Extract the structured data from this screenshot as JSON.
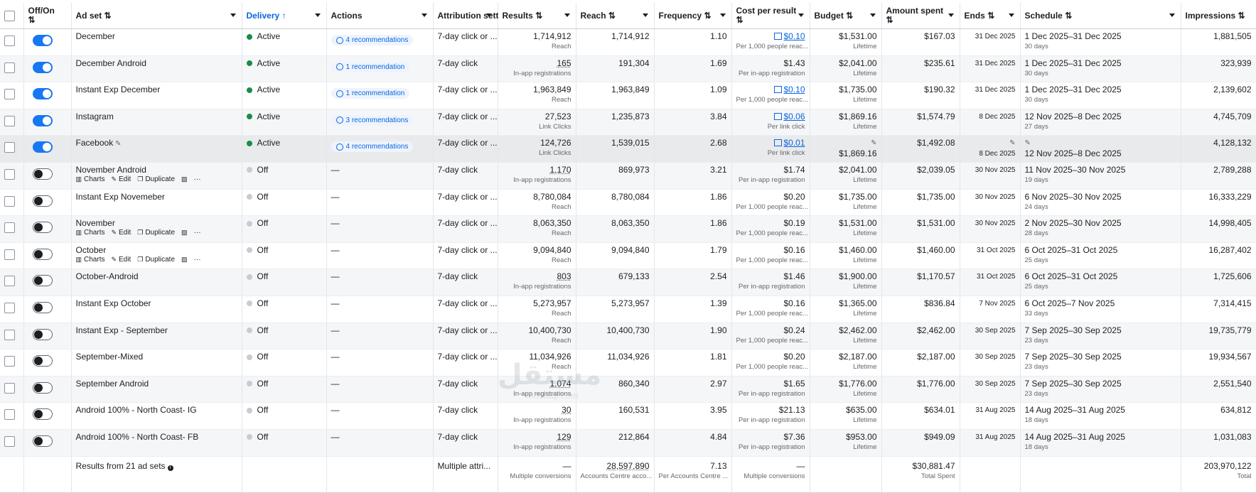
{
  "columns": {
    "off_on": "Off/On",
    "ad_set": "Ad set",
    "delivery": "Delivery",
    "actions": "Actions",
    "attribution": "Attribution setting",
    "results": "Results",
    "reach": "Reach",
    "frequency": "Frequency",
    "cost_per_result": "Cost per result",
    "budget": "Budget",
    "amount_spent": "Amount spent",
    "ends": "Ends",
    "schedule": "Schedule",
    "impressions": "Impressions"
  },
  "row_actions": {
    "charts": "Charts",
    "edit": "Edit",
    "duplicate": "Duplicate",
    "more": "···"
  },
  "rows": [
    {
      "on": true,
      "name": "December",
      "delivery": "Active",
      "actions": "4 recommendations",
      "attribution": "7-day click or ...",
      "results": "1,714,912",
      "results_type": "Reach",
      "reach": "1,714,912",
      "frequency": "1.10",
      "cpr": "$0.10",
      "cpr_sub": "Per 1,000 people reac...",
      "cpr_link": true,
      "budget": "$1,531.00",
      "budget_type": "Lifetime",
      "spent": "$167.03",
      "ends": "31 Dec 2025",
      "schedule": "1 Dec 2025–31 Dec 2025",
      "schedule_sub": "30 days",
      "impressions": "1,881,505"
    },
    {
      "on": true,
      "name": "December Android",
      "delivery": "Active",
      "actions": "1 recommendation",
      "attribution": "7-day click",
      "results": "165",
      "results_type": "In-app registrations",
      "reach": "191,304",
      "frequency": "1.69",
      "cpr": "$1.43",
      "cpr_sub": "Per in-app registration",
      "cpr_link": false,
      "budget": "$2,041.00",
      "budget_type": "Lifetime",
      "spent": "$235.61",
      "ends": "31 Dec 2025",
      "schedule": "1 Dec 2025–31 Dec 2025",
      "schedule_sub": "30 days",
      "impressions": "323,939"
    },
    {
      "on": true,
      "name": "Instant Exp December",
      "delivery": "Active",
      "actions": "1 recommendation",
      "attribution": "7-day click or ...",
      "results": "1,963,849",
      "results_type": "Reach",
      "reach": "1,963,849",
      "frequency": "1.09",
      "cpr": "$0.10",
      "cpr_sub": "Per 1,000 people reac...",
      "cpr_link": true,
      "budget": "$1,735.00",
      "budget_type": "Lifetime",
      "spent": "$190.32",
      "ends": "31 Dec 2025",
      "schedule": "1 Dec 2025–31 Dec 2025",
      "schedule_sub": "30 days",
      "impressions": "2,139,602"
    },
    {
      "on": true,
      "name": "Instagram",
      "delivery": "Active",
      "actions": "3 recommendations",
      "attribution": "7-day click or ...",
      "results": "27,523",
      "results_type": "Link Clicks",
      "reach": "1,235,873",
      "frequency": "3.84",
      "cpr": "$0.06",
      "cpr_sub": "Per link click",
      "cpr_link": true,
      "budget": "$1,869.16",
      "budget_type": "Lifetime",
      "spent": "$1,574.79",
      "ends": "8 Dec 2025",
      "schedule": "12 Nov 2025–8 Dec 2025",
      "schedule_sub": "27 days",
      "impressions": "4,745,709"
    },
    {
      "on": true,
      "name": "Facebook",
      "delivery": "Active",
      "actions": "4 recommendations",
      "attribution": "7-day click or ...",
      "results": "124,726",
      "results_type": "Link Clicks",
      "reach": "1,539,015",
      "frequency": "2.68",
      "cpr": "$0.01",
      "cpr_sub": "Per link click",
      "cpr_link": true,
      "budget": "$1,869.16",
      "budget_type": "",
      "spent": "$1,492.08",
      "ends": "8 Dec 2025",
      "schedule": "12 Nov 2025–8 Dec 2025",
      "schedule_sub": "",
      "impressions": "4,128,132",
      "selected": true
    },
    {
      "on": false,
      "name": "November Android",
      "delivery": "Off",
      "actions": "—",
      "attribution": "7-day click",
      "results": "1,170",
      "results_type": "In-app registrations",
      "reach": "869,973",
      "frequency": "3.21",
      "cpr": "$1.74",
      "cpr_sub": "Per in-app registration",
      "cpr_link": false,
      "budget": "$2,041.00",
      "budget_type": "Lifetime",
      "spent": "$2,039.05",
      "ends": "30 Nov 2025",
      "schedule": "11 Nov 2025–30 Nov 2025",
      "schedule_sub": "19 days",
      "impressions": "2,789,288",
      "hover": true
    },
    {
      "on": false,
      "name": "Instant Exp Novemeber",
      "delivery": "Off",
      "actions": "—",
      "attribution": "7-day click or ...",
      "results": "8,780,084",
      "results_type": "Reach",
      "reach": "8,780,084",
      "frequency": "1.86",
      "cpr": "$0.20",
      "cpr_sub": "Per 1,000 people reac...",
      "cpr_link": false,
      "budget": "$1,735.00",
      "budget_type": "Lifetime",
      "spent": "$1,735.00",
      "ends": "30 Nov 2025",
      "schedule": "6 Nov 2025–30 Nov 2025",
      "schedule_sub": "24 days",
      "impressions": "16,333,229"
    },
    {
      "on": false,
      "name": "November",
      "delivery": "Off",
      "actions": "—",
      "attribution": "7-day click or ...",
      "results": "8,063,350",
      "results_type": "Reach",
      "reach": "8,063,350",
      "frequency": "1.86",
      "cpr": "$0.19",
      "cpr_sub": "Per 1,000 people reac...",
      "cpr_link": false,
      "budget": "$1,531.00",
      "budget_type": "Lifetime",
      "spent": "$1,531.00",
      "ends": "30 Nov 2025",
      "schedule": "2 Nov 2025–30 Nov 2025",
      "schedule_sub": "28 days",
      "impressions": "14,998,405",
      "hover": true
    },
    {
      "on": false,
      "name": "October",
      "delivery": "Off",
      "actions": "—",
      "attribution": "7-day click or ...",
      "results": "9,094,840",
      "results_type": "Reach",
      "reach": "9,094,840",
      "frequency": "1.79",
      "cpr": "$0.16",
      "cpr_sub": "Per 1,000 people reac...",
      "cpr_link": false,
      "budget": "$1,460.00",
      "budget_type": "Lifetime",
      "spent": "$1,460.00",
      "ends": "31 Oct 2025",
      "schedule": "6 Oct 2025–31 Oct 2025",
      "schedule_sub": "25 days",
      "impressions": "16,287,402",
      "hover": true
    },
    {
      "on": false,
      "name": "October-Android",
      "delivery": "Off",
      "actions": "—",
      "attribution": "7-day click",
      "results": "803",
      "results_type": "In-app registrations",
      "reach": "679,133",
      "frequency": "2.54",
      "cpr": "$1.46",
      "cpr_sub": "Per in-app registration",
      "cpr_link": false,
      "budget": "$1,900.00",
      "budget_type": "Lifetime",
      "spent": "$1,170.57",
      "ends": "31 Oct 2025",
      "schedule": "6 Oct 2025–31 Oct 2025",
      "schedule_sub": "25 days",
      "impressions": "1,725,606"
    },
    {
      "on": false,
      "name": "Instant Exp October",
      "delivery": "Off",
      "actions": "—",
      "attribution": "7-day click or ...",
      "results": "5,273,957",
      "results_type": "Reach",
      "reach": "5,273,957",
      "frequency": "1.39",
      "cpr": "$0.16",
      "cpr_sub": "Per 1,000 people reac...",
      "cpr_link": false,
      "budget": "$1,365.00",
      "budget_type": "Lifetime",
      "spent": "$836.84",
      "ends": "7 Nov 2025",
      "schedule": "6 Oct 2025–7 Nov 2025",
      "schedule_sub": "33 days",
      "impressions": "7,314,415"
    },
    {
      "on": false,
      "name": "Instant Exp - September",
      "delivery": "Off",
      "actions": "—",
      "attribution": "7-day click or ...",
      "results": "10,400,730",
      "results_type": "Reach",
      "reach": "10,400,730",
      "frequency": "1.90",
      "cpr": "$0.24",
      "cpr_sub": "Per 1,000 people reac...",
      "cpr_link": false,
      "budget": "$2,462.00",
      "budget_type": "Lifetime",
      "spent": "$2,462.00",
      "ends": "30 Sep 2025",
      "schedule": "7 Sep 2025–30 Sep 2025",
      "schedule_sub": "23 days",
      "impressions": "19,735,779"
    },
    {
      "on": false,
      "name": "September-Mixed",
      "delivery": "Off",
      "actions": "—",
      "attribution": "7-day click or ...",
      "results": "11,034,926",
      "results_type": "Reach",
      "reach": "11,034,926",
      "frequency": "1.81",
      "cpr": "$0.20",
      "cpr_sub": "Per 1,000 people reac...",
      "cpr_link": false,
      "budget": "$2,187.00",
      "budget_type": "Lifetime",
      "spent": "$2,187.00",
      "ends": "30 Sep 2025",
      "schedule": "7 Sep 2025–30 Sep 2025",
      "schedule_sub": "23 days",
      "impressions": "19,934,567"
    },
    {
      "on": false,
      "name": "September Android",
      "delivery": "Off",
      "actions": "—",
      "attribution": "7-day click",
      "results": "1,074",
      "results_type": "In-app registrations",
      "reach": "860,340",
      "frequency": "2.97",
      "cpr": "$1.65",
      "cpr_sub": "Per in-app registration",
      "cpr_link": false,
      "budget": "$1,776.00",
      "budget_type": "Lifetime",
      "spent": "$1,776.00",
      "ends": "30 Sep 2025",
      "schedule": "7 Sep 2025–30 Sep 2025",
      "schedule_sub": "23 days",
      "impressions": "2,551,540"
    },
    {
      "on": false,
      "name": "Android 100% - North Coast- IG",
      "delivery": "Off",
      "actions": "—",
      "attribution": "7-day click",
      "results": "30",
      "results_type": "In-app registrations",
      "reach": "160,531",
      "frequency": "3.95",
      "cpr": "$21.13",
      "cpr_sub": "Per in-app registration",
      "cpr_link": false,
      "budget": "$635.00",
      "budget_type": "Lifetime",
      "spent": "$634.01",
      "ends": "31 Aug 2025",
      "schedule": "14 Aug 2025–31 Aug 2025",
      "schedule_sub": "18 days",
      "impressions": "634,812"
    },
    {
      "on": false,
      "name": "Android 100% - North Coast- FB",
      "delivery": "Off",
      "actions": "—",
      "attribution": "7-day click",
      "results": "129",
      "results_type": "In-app registrations",
      "reach": "212,864",
      "frequency": "4.84",
      "cpr": "$7.36",
      "cpr_sub": "Per in-app registration",
      "cpr_link": false,
      "budget": "$953.00",
      "budget_type": "Lifetime",
      "spent": "$949.09",
      "ends": "31 Aug 2025",
      "schedule": "14 Aug 2025–31 Aug 2025",
      "schedule_sub": "18 days",
      "impressions": "1,031,083"
    }
  ],
  "footer": {
    "label": "Results from 21 ad sets",
    "attribution": "Multiple attri...",
    "results": "—",
    "results_sub": "Multiple conversions",
    "reach": "28,597,890",
    "reach_sub": "Accounts Centre acco...",
    "frequency": "7.13",
    "frequency_sub": "Per Accounts Centre ...",
    "cpr": "—",
    "cpr_sub": "Multiple conversions",
    "spent": "$30,881.47",
    "spent_sub": "Total Spent",
    "impressions": "203,970,122",
    "impressions_sub": "Total"
  },
  "watermark": {
    "arabic": "مستقل",
    "latin": "mostaql.com"
  },
  "colors": {
    "link": "#0a66e0",
    "active": "#1a8d45",
    "toggle_on": "#1877f2"
  }
}
